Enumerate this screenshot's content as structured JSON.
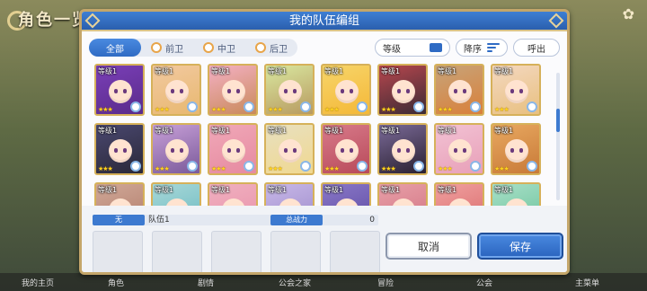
{
  "background": {
    "title": "角色一览",
    "bottom_items": [
      "我的主页",
      "角色",
      "剧情",
      "公会之家",
      "冒险",
      "公会",
      "主菜单"
    ]
  },
  "modal": {
    "title": "我的队伍编组"
  },
  "filters": {
    "tabs": [
      {
        "label": "全部",
        "active": true
      },
      {
        "label": "前卫",
        "active": false
      },
      {
        "label": "中卫",
        "active": false
      },
      {
        "label": "后卫",
        "active": false
      }
    ],
    "level_label": "等级",
    "sort_label": "降序",
    "summon_label": "呼出"
  },
  "characters": [
    {
      "level": "等级1",
      "stars": "★★★",
      "bg": "#7a3fb8",
      "hair": "#5a2b8a"
    },
    {
      "level": "等级1",
      "stars": "★★★",
      "bg": "#f2c9a0",
      "hair": "#e8b870"
    },
    {
      "level": "等级1",
      "stars": "★★★",
      "bg": "#f4b0c4",
      "hair": "#c98a5a"
    },
    {
      "level": "等级1",
      "stars": "★★★",
      "bg": "#d9e8a0",
      "hair": "#b89a60"
    },
    {
      "level": "等级1",
      "stars": "★★★",
      "bg": "#f7d56a",
      "hair": "#f4b838"
    },
    {
      "level": "等级1",
      "stars": "★★★",
      "bg": "#b8474e",
      "hair": "#3a2a34"
    },
    {
      "level": "等级1",
      "stars": "★★★",
      "bg": "#c7a47a",
      "hair": "#d9803a"
    },
    {
      "level": "等级1",
      "stars": "★★★",
      "bg": "#f4d8c0",
      "hair": "#e8c080"
    },
    {
      "level": "等级1",
      "stars": "★★★",
      "bg": "#4a4870",
      "hair": "#2a2838"
    },
    {
      "level": "等级1",
      "stars": "★★★",
      "bg": "#c8a0d8",
      "hair": "#7a5a9a"
    },
    {
      "level": "等级1",
      "stars": "★★★",
      "bg": "#f0a8b8",
      "hair": "#e68aa0"
    },
    {
      "level": "等级1",
      "stars": "★★★",
      "bg": "#e8e0c0",
      "hair": "#f0d890"
    },
    {
      "level": "等级1",
      "stars": "★★★",
      "bg": "#d87a8a",
      "hair": "#b84a5a"
    },
    {
      "level": "等级1",
      "stars": "★★★",
      "bg": "#7a6a98",
      "hair": "#2a2030"
    },
    {
      "level": "等级1",
      "stars": "★★★",
      "bg": "#f2c2d4",
      "hair": "#e8a0b8"
    },
    {
      "level": "等级1",
      "stars": "★★★",
      "bg": "#e8a860",
      "hair": "#c87a38"
    },
    {
      "level": "等级1",
      "stars": "",
      "bg": "#d0a898",
      "hair": "#b07a68"
    },
    {
      "level": "等级1",
      "stars": "",
      "bg": "#a8d8d8",
      "hair": "#68b8c0"
    },
    {
      "level": "等级1",
      "stars": "",
      "bg": "#f0b0c0",
      "hair": "#e890a8"
    },
    {
      "level": "等级1",
      "stars": "",
      "bg": "#c8b8e8",
      "hair": "#9a88c8"
    },
    {
      "level": "等级1",
      "stars": "",
      "bg": "#8a78c8",
      "hair": "#5a48a0"
    },
    {
      "level": "等级1",
      "stars": "",
      "bg": "#e8a0a8",
      "hair": "#d07080"
    },
    {
      "level": "等级1",
      "stars": "",
      "bg": "#f0a0a0",
      "hair": "#d86868"
    },
    {
      "level": "等级1",
      "stars": "",
      "bg": "#a8e0c8",
      "hair": "#68c098"
    }
  ],
  "team": {
    "tag_label": "无",
    "name": "队伍1",
    "power_label": "总战力",
    "power_value": "0"
  },
  "buttons": {
    "cancel": "取消",
    "save": "保存"
  }
}
